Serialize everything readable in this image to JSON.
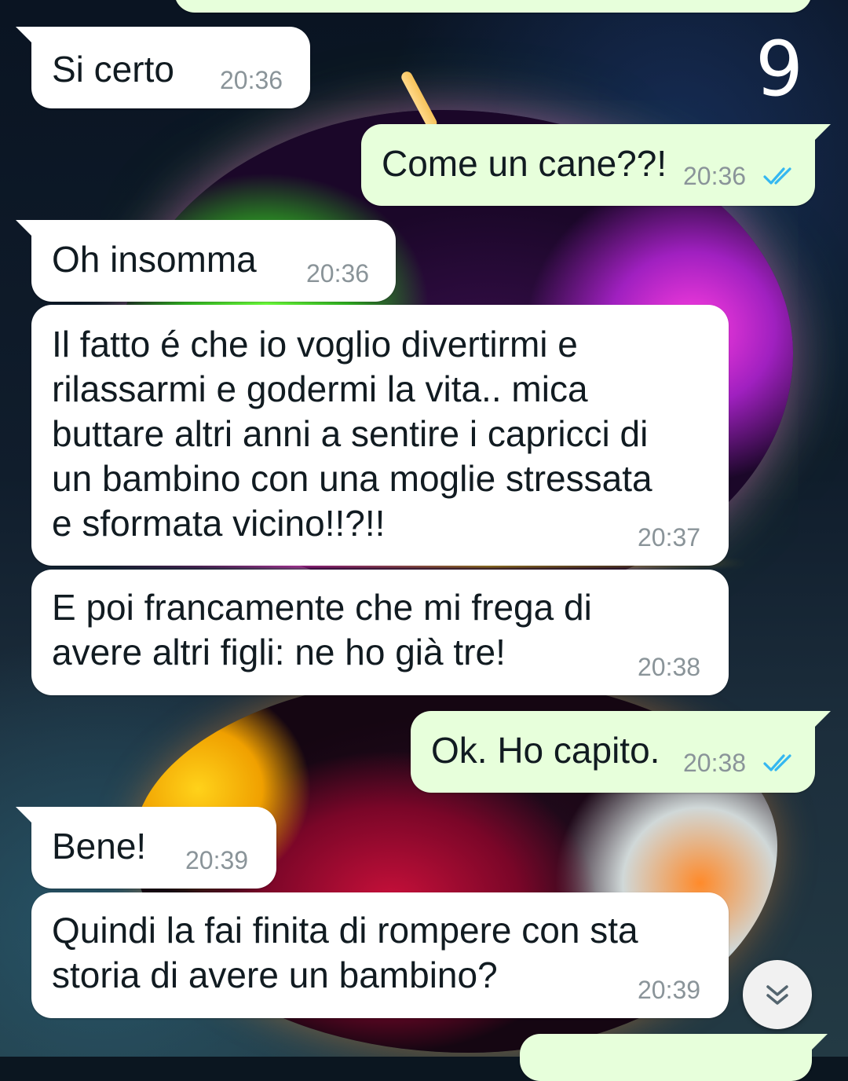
{
  "overlay": {
    "page_number": "9"
  },
  "colors": {
    "incoming_bubble": "#ffffff",
    "outgoing_bubble": "#e7ffdb",
    "read_ticks": "#34b7f1",
    "timestamp": "#8a9499"
  },
  "messages": [
    {
      "direction": "in",
      "text": "Si certo",
      "time": "20:36"
    },
    {
      "direction": "out",
      "text": "Come un cane??!",
      "time": "20:36",
      "status": "read"
    },
    {
      "direction": "in",
      "text": "Oh insomma",
      "time": "20:36"
    },
    {
      "direction": "in",
      "lines": [
        "Il fatto é che io voglio divertirmi e",
        "rilassarmi e godermi la vita.. mica",
        "buttare altri anni a sentire i capricci di",
        "un bambino con una moglie stressata",
        "e sformata vicino!!?!!"
      ],
      "time": "20:37"
    },
    {
      "direction": "in",
      "lines": [
        "E poi francamente che mi frega di",
        "avere altri figli: ne ho già tre!"
      ],
      "time": "20:38"
    },
    {
      "direction": "out",
      "text": "Ok. Ho capito.",
      "time": "20:38",
      "status": "read"
    },
    {
      "direction": "in",
      "text": "Bene!",
      "time": "20:39"
    },
    {
      "direction": "in",
      "lines": [
        "Quindi la fai finita di rompere con sta",
        "storia di avere un bambino?"
      ],
      "time": "20:39"
    }
  ],
  "scroll_button": {
    "icon": "double-chevron-down-icon"
  }
}
